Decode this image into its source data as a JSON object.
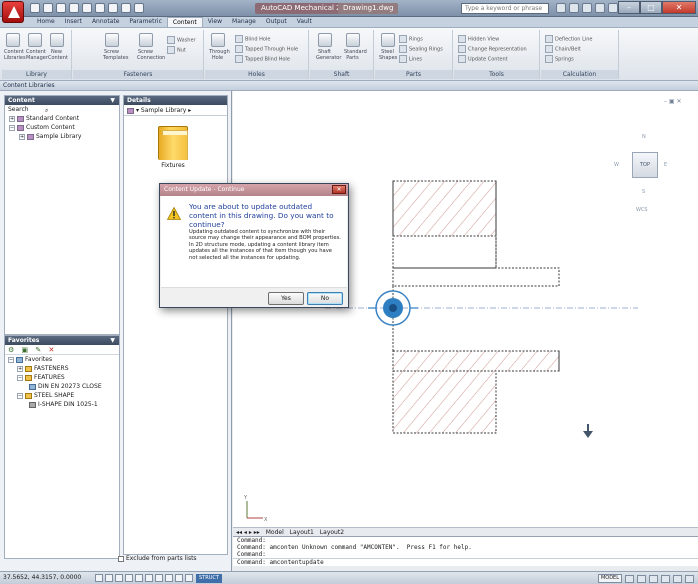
{
  "titlebar": {
    "document_title": "AutoCAD Mechanical 2011",
    "document_name": "Drawing1.dwg",
    "search_placeholder": "Type a keyword or phrase"
  },
  "ribbon": {
    "tabs": [
      "Home",
      "Insert",
      "Annotate",
      "Parametric",
      "Content",
      "View",
      "Manage",
      "Output",
      "Vault"
    ],
    "active_tab": "Content",
    "panels": [
      {
        "label": "Library",
        "tools": [
          "Content Libraries",
          "Content Manager",
          "New Content"
        ]
      },
      {
        "label": "Fasteners",
        "tools": [
          "Screw Templates",
          "Screw Connection",
          "Washer",
          "Nut"
        ]
      },
      {
        "label": "Holes",
        "tools": [
          "Through Hole",
          "Blind Hole",
          "Tapped Through Hole",
          "Tapped Blind Hole"
        ]
      },
      {
        "label": "Shaft",
        "tools": [
          "Shaft Generator",
          "Standard Parts"
        ]
      },
      {
        "label": "Parts",
        "tools": [
          "Steel Shapes",
          "Rings",
          "Sealing Rings",
          "Lines"
        ]
      },
      {
        "label": "Tools",
        "tools": [
          "Hidden View",
          "Change Representation",
          "Update Content"
        ]
      },
      {
        "label": "Calculation",
        "tools": [
          "Deflection Line",
          "Chain/Belt",
          "Springs"
        ]
      }
    ]
  },
  "palette": {
    "title": "Content Libraries",
    "content_pane": {
      "header": "Content",
      "search_label": "Search",
      "tree": [
        {
          "label": "Standard Content",
          "level": 1
        },
        {
          "label": "Custom Content",
          "level": 1
        },
        {
          "label": "Sample Library",
          "level": 2
        }
      ]
    },
    "details_pane": {
      "header": "Details",
      "breadcrumb": "Sample Library",
      "folder_label": "Fixtures"
    },
    "favorites_pane": {
      "header": "Favorites",
      "tree": [
        {
          "label": "Favorites",
          "level": 0
        },
        {
          "label": "FASTENERS",
          "level": 1
        },
        {
          "label": "FEATURES",
          "level": 1
        },
        {
          "label": "DIN EN 20273 CLOSE",
          "level": 2
        },
        {
          "label": "STEEL SHAPE",
          "level": 1
        },
        {
          "label": "I-SHAPE DIN 1025-1",
          "level": 2
        }
      ]
    },
    "exclude_label": "Exclude from parts lists"
  },
  "dialog": {
    "title": "Content Update - Continue",
    "heading": "You are about to update outdated content in this drawing. Do you want to continue?",
    "body": "Updating outdated content to synchronize with their source may change their appearance and BOM properties. In 2D structure mode, updating a content library item updates all the instances of that item though you have not selected all the instances for updating.",
    "yes_label": "Yes",
    "no_label": "No"
  },
  "viewcube": {
    "face": "TOP",
    "north": "N",
    "south": "S",
    "west": "W",
    "east": "E",
    "wcs": "WCS"
  },
  "model_tabs": [
    "Model",
    "Layout1",
    "Layout2"
  ],
  "command_history": [
    "Command:",
    "Command: amconten Unknown command \"AMCONTEN\".  Press F1 for help.",
    "Command:"
  ],
  "command_input": "Command: amcontentupdate",
  "statusbar": {
    "coords": "37.5652, 44.3157, 0.0000",
    "struct_label": "STRUCT",
    "model_label": "MODEL"
  },
  "colors": {
    "hatch": "#c98b86",
    "outline": "#3a3a3a",
    "centerline": "#7f98c8",
    "accent": "#2d7fc1",
    "dialog_heading": "#1f3e9a"
  }
}
